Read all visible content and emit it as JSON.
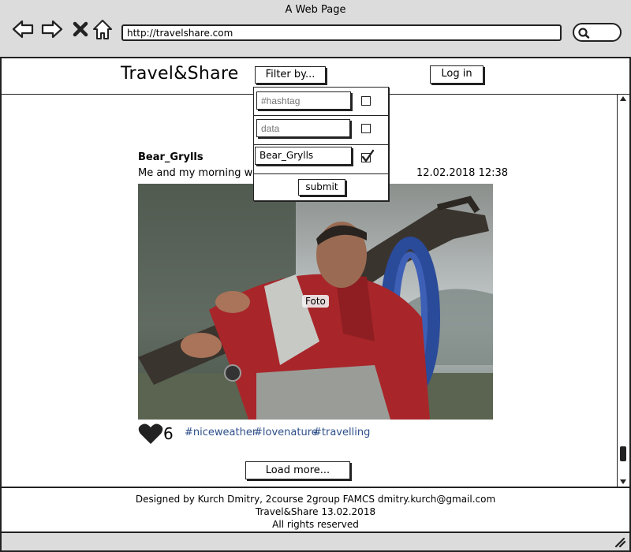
{
  "window": {
    "title": "A Web Page"
  },
  "address_bar": {
    "url": "http://travelshare.com"
  },
  "header": {
    "brand": "Travel&Share",
    "filter_label": "Filter by...",
    "login_label": "Log in"
  },
  "filter": {
    "fields": [
      {
        "placeholder": "#hashtag",
        "value": "",
        "checked": false
      },
      {
        "placeholder": "data",
        "value": "",
        "checked": false
      },
      {
        "placeholder": "",
        "value": "Bear_Grylls",
        "checked": true
      }
    ],
    "submit_label": "submit"
  },
  "post": {
    "author": "Bear_Grylls",
    "caption": "Me and my morning wood",
    "date": "12.02.2018 12:38",
    "photo_label": "Foto",
    "likes": "6",
    "hashtags": [
      "#niceweather",
      "#lovenature",
      "#travelling"
    ]
  },
  "load_more_label": "Load more...",
  "footer": {
    "line1": "Designed by Kurch Dmitry, 2course 2group FAMCS dmitry.kurch@gmail.com",
    "line2": "Travel&Share 13.02.2018",
    "line3": "All rights reserved"
  },
  "icons": {
    "back": "arrow-left-icon",
    "forward": "arrow-right-icon",
    "stop": "close-icon",
    "home": "home-icon",
    "search": "search-icon",
    "like": "heart-icon",
    "check": "checkmark-icon",
    "resize": "resize-grip-icon"
  },
  "colors": {
    "chrome": "#dcdcdc",
    "hashtag": "#2e4f8a",
    "border": "#222222"
  }
}
